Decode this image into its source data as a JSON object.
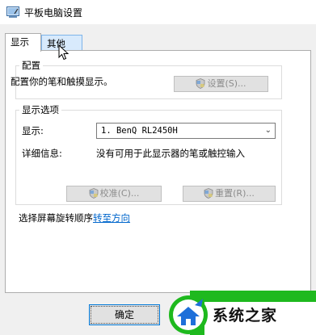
{
  "window": {
    "title": "平板电脑设置"
  },
  "tabs": [
    {
      "label": "显示"
    },
    {
      "label": "其他"
    }
  ],
  "config_group": {
    "title": "配置",
    "description": "配置你的笔和触摸显示。",
    "settings_button": "设置(S)..."
  },
  "display_group": {
    "title": "显示选项",
    "display_label": "显示:",
    "display_value": "1. BenQ RL2450H",
    "details_label": "详细信息:",
    "details_value": "没有可用于此显示器的笔或触控输入",
    "calibrate_button": "校准(C)...",
    "reset_button": "重置(R)..."
  },
  "rotation": {
    "text": "选择屏幕旋转顺序",
    "link": "转至方向"
  },
  "ok_button": "确定",
  "watermark": {
    "text": "系统之家"
  },
  "colors": {
    "accent": "#0078d7",
    "link": "#0066cc",
    "watermark_green": "#1eb91e"
  }
}
